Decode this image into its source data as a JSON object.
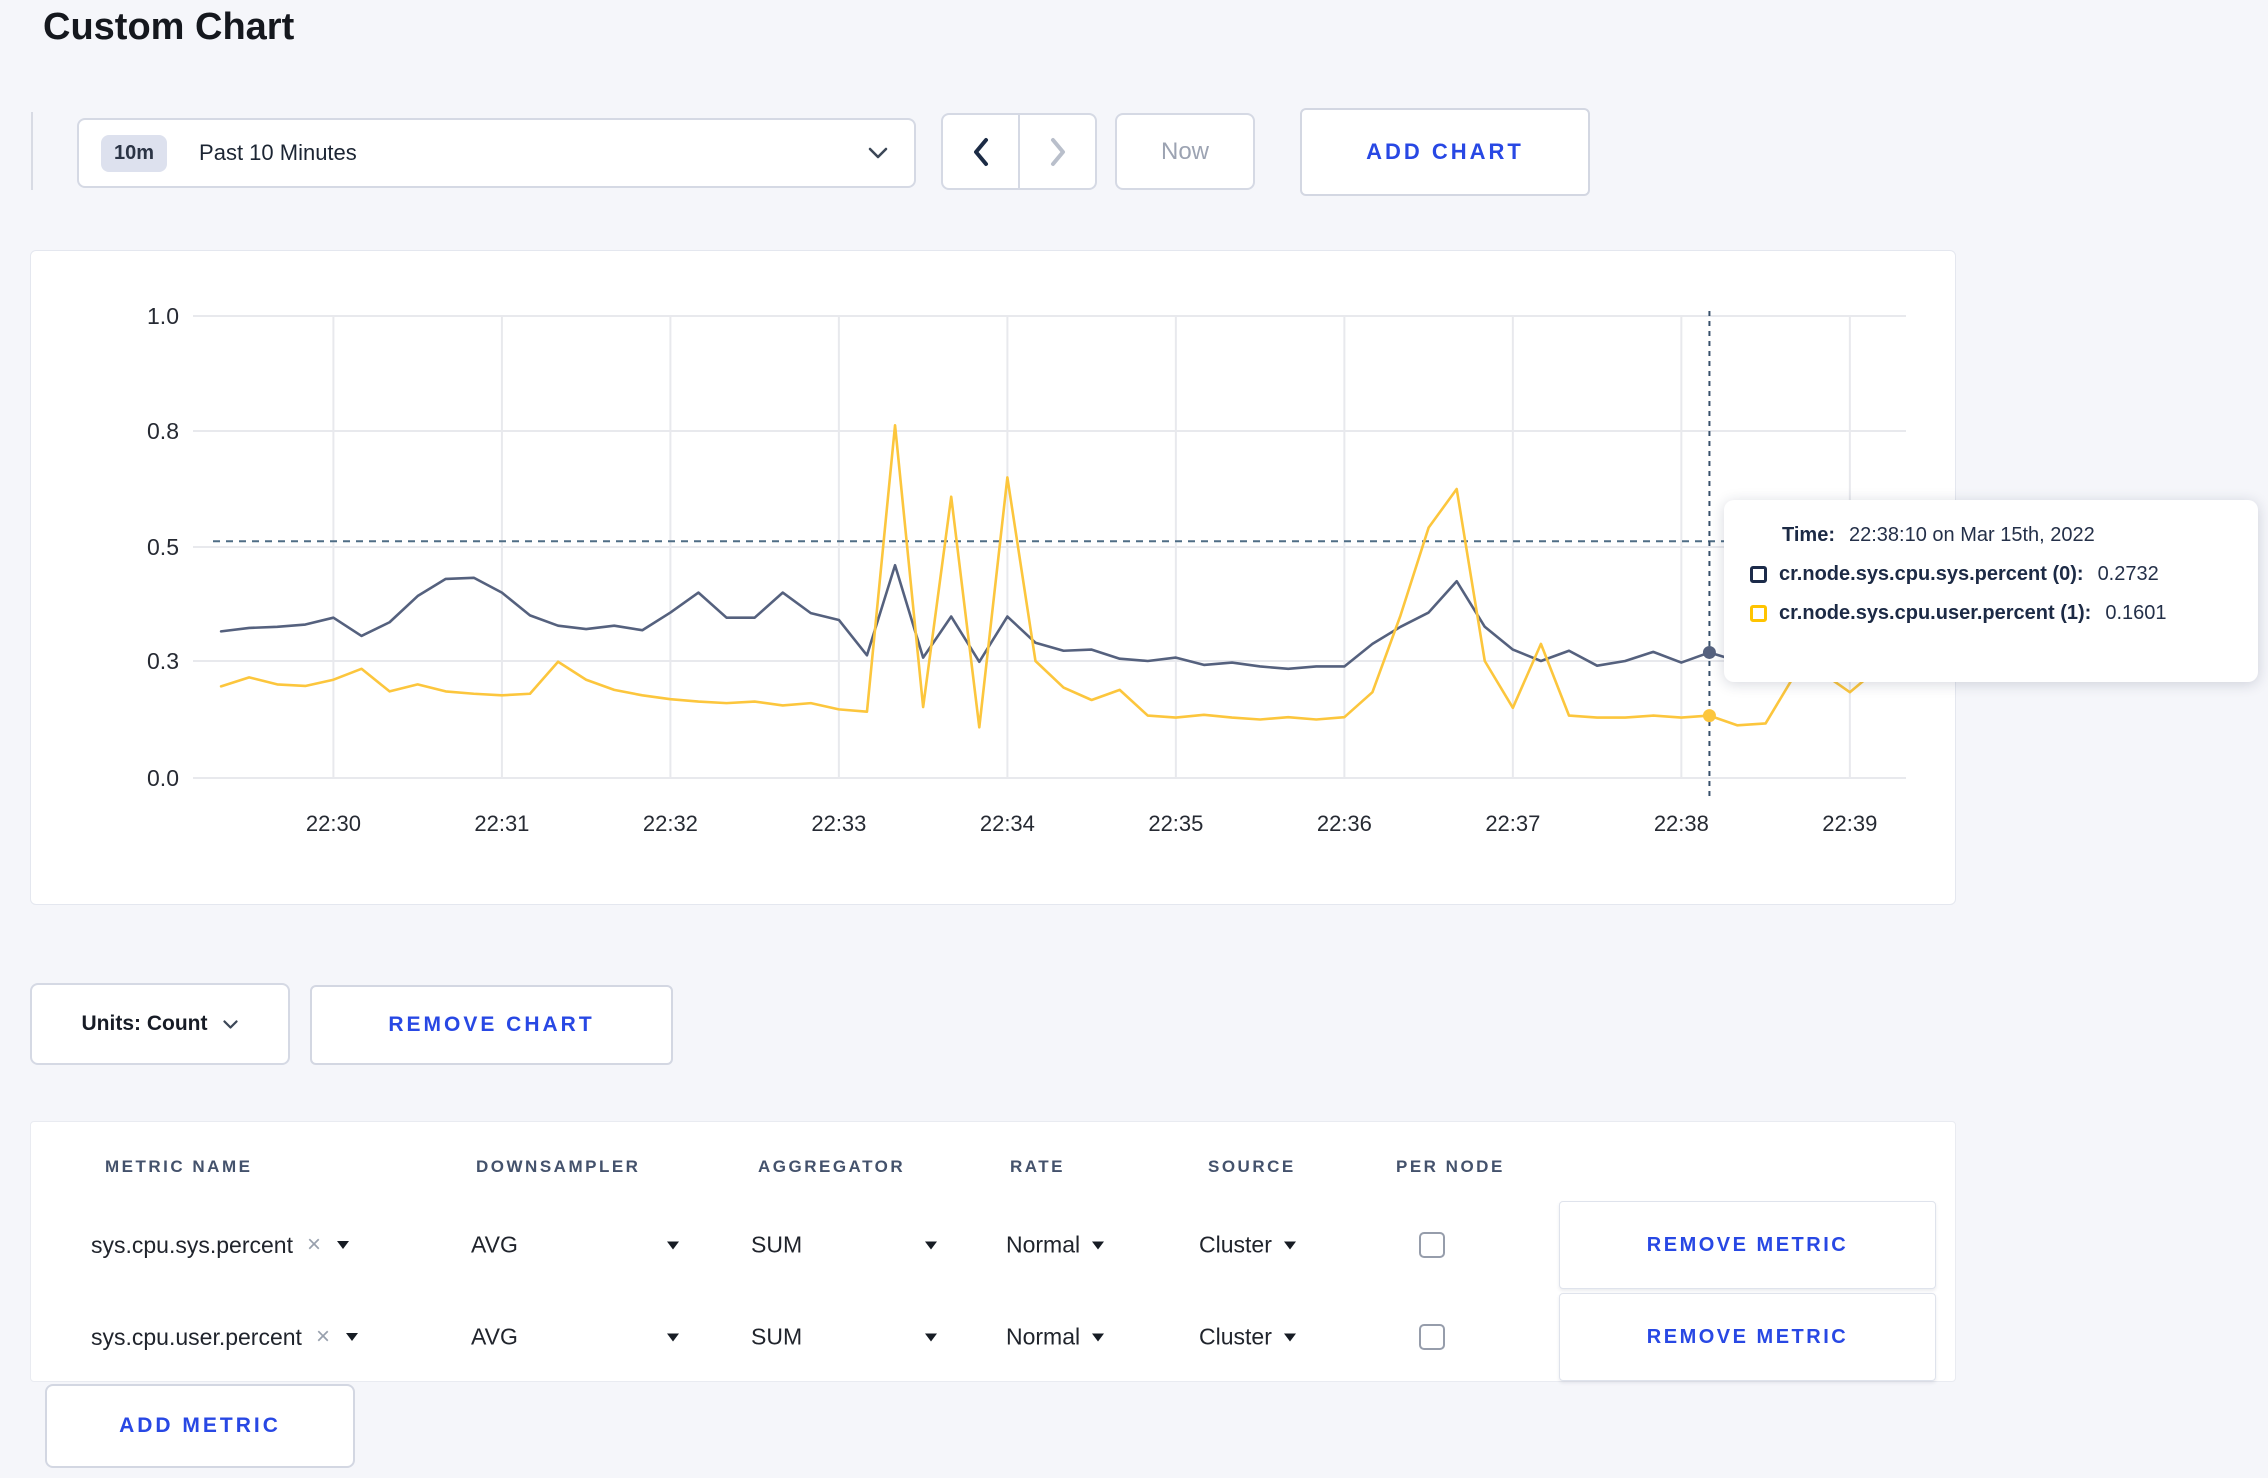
{
  "page": {
    "title": "Custom Chart"
  },
  "toolbar": {
    "time_window_badge": "10m",
    "time_window_label": "Past 10 Minutes",
    "now_label": "Now",
    "add_chart_label": "ADD CHART"
  },
  "chart": {
    "units_label": "Units: Count",
    "remove_chart_label": "REMOVE CHART",
    "tooltip": {
      "time_label": "Time:",
      "time_value": "22:38:10 on Mar 15th, 2022",
      "series": [
        {
          "label": "cr.node.sys.cpu.sys.percent (0):",
          "value": "0.2732",
          "color": "#1c2b4a"
        },
        {
          "label": "cr.node.sys.cpu.user.percent (1):",
          "value": "0.1601",
          "color": "#ffc400"
        }
      ]
    }
  },
  "chart_data": {
    "type": "line",
    "title": "",
    "xlabel": "",
    "ylabel": "",
    "x_tick_labels": [
      "22:30",
      "22:31",
      "22:32",
      "22:33",
      "22:34",
      "22:35",
      "22:36",
      "22:37",
      "22:38",
      "22:39"
    ],
    "y_tick_labels": [
      "0.0",
      "0.3",
      "0.5",
      "0.8",
      "1.0"
    ],
    "y_tick_values": [
      0.0,
      0.3,
      0.5,
      0.8,
      1.0
    ],
    "grid": true,
    "start_time": "22:29:20",
    "interval_seconds": 10,
    "threshold_dashed_line": 0.515,
    "crosshair": {
      "time": "22:38:10",
      "point_index": 53
    },
    "series": [
      {
        "name": "cr.node.sys.cpu.sys.percent",
        "color": "#55617e",
        "values": [
          0.352,
          0.358,
          0.36,
          0.364,
          0.376,
          0.344,
          0.368,
          0.414,
          0.444,
          0.446,
          0.42,
          0.38,
          0.362,
          0.356,
          0.362,
          0.354,
          0.385,
          0.42,
          0.376,
          0.376,
          0.42,
          0.384,
          0.372,
          0.31,
          0.468,
          0.306,
          0.378,
          0.298,
          0.378,
          0.332,
          0.318,
          0.32,
          0.304,
          0.3,
          0.306,
          0.29,
          0.296,
          0.286,
          0.28,
          0.286,
          0.286,
          0.33,
          0.36,
          0.385,
          0.44,
          0.36,
          0.32,
          0.3,
          0.318,
          0.288,
          0.3,
          0.316,
          0.296,
          0.315,
          0.3,
          0.298,
          0.302,
          0.3,
          0.298,
          0.304
        ]
      },
      {
        "name": "cr.node.sys.cpu.user.percent",
        "color": "#fcc63d",
        "values": [
          0.235,
          0.258,
          0.24,
          0.236,
          0.252,
          0.28,
          0.222,
          0.24,
          0.222,
          0.216,
          0.212,
          0.216,
          0.298,
          0.252,
          0.226,
          0.212,
          0.202,
          0.196,
          0.192,
          0.196,
          0.186,
          0.192,
          0.176,
          0.17,
          0.81,
          0.182,
          0.63,
          0.13,
          0.68,
          0.3,
          0.232,
          0.2,
          0.226,
          0.16,
          0.155,
          0.162,
          0.155,
          0.15,
          0.156,
          0.15,
          0.156,
          0.22,
          0.38,
          0.55,
          0.65,
          0.3,
          0.18,
          0.33,
          0.16,
          0.155,
          0.155,
          0.16,
          0.155,
          0.16,
          0.135,
          0.14,
          0.26,
          0.27,
          0.22,
          0.28
        ]
      }
    ]
  },
  "metrics_table": {
    "headers": [
      "METRIC NAME",
      "DOWNSAMPLER",
      "AGGREGATOR",
      "RATE",
      "SOURCE",
      "PER NODE"
    ],
    "rows": [
      {
        "metric": "sys.cpu.sys.percent",
        "downsampler": "AVG",
        "aggregator": "SUM",
        "rate": "Normal",
        "source": "Cluster",
        "per_node": false,
        "remove_label": "REMOVE METRIC"
      },
      {
        "metric": "sys.cpu.user.percent",
        "downsampler": "AVG",
        "aggregator": "SUM",
        "rate": "Normal",
        "source": "Cluster",
        "per_node": false,
        "remove_label": "REMOVE METRIC"
      }
    ],
    "add_metric_label": "ADD METRIC"
  }
}
